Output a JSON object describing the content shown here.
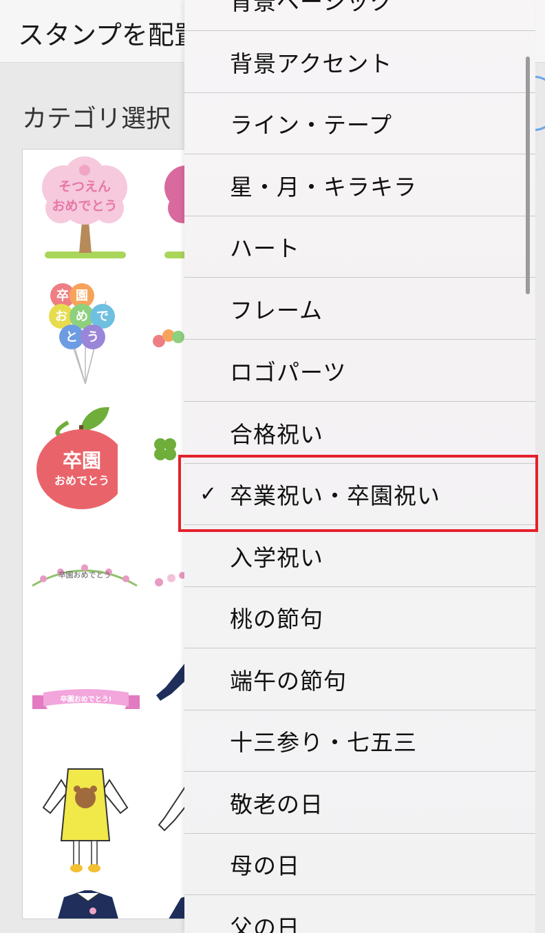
{
  "header": {
    "title": "スタンプを配置"
  },
  "category": {
    "label": "カテゴリ選択"
  },
  "stamps": {
    "stamp1_line1": "そつえん",
    "stamp1_line2": "おめでとう",
    "balloon_chars": [
      "卒",
      "園",
      "お",
      "め",
      "で",
      "と",
      "う"
    ],
    "apple_line1": "卒園",
    "apple_line2": "おめでとう",
    "wreath_text": "卒園おめでとう",
    "ribbon_text": "卒園おめでとう!"
  },
  "dropdown": {
    "items": [
      {
        "label": "背景ベーシック",
        "checked": false
      },
      {
        "label": "背景アクセント",
        "checked": false
      },
      {
        "label": "ライン・テープ",
        "checked": false
      },
      {
        "label": "星・月・キラキラ",
        "checked": false
      },
      {
        "label": "ハート",
        "checked": false
      },
      {
        "label": "フレーム",
        "checked": false
      },
      {
        "label": "ロゴパーツ",
        "checked": false
      },
      {
        "label": "合格祝い",
        "checked": false
      },
      {
        "label": "卒業祝い・卒園祝い",
        "checked": true
      },
      {
        "label": "入学祝い",
        "checked": false
      },
      {
        "label": "桃の節句",
        "checked": false
      },
      {
        "label": "端午の節句",
        "checked": false
      },
      {
        "label": "十三参り・七五三",
        "checked": false
      },
      {
        "label": "敬老の日",
        "checked": false
      },
      {
        "label": "母の日",
        "checked": false
      },
      {
        "label": "父の日",
        "checked": false
      }
    ],
    "check_mark": "✓"
  },
  "colors": {
    "highlight": "#e5202a",
    "accent": "#6aa5e8"
  }
}
